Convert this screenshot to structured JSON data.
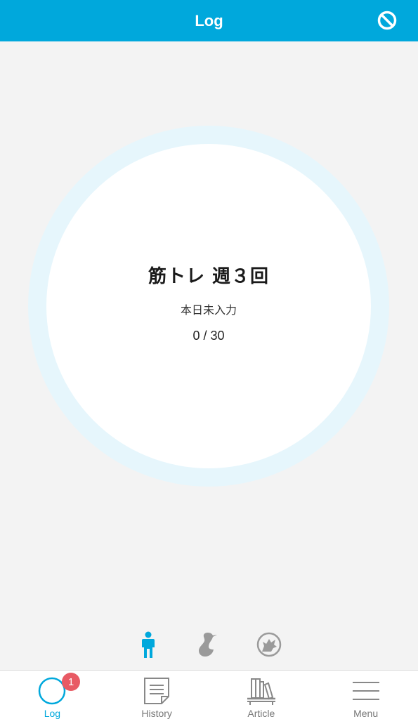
{
  "header": {
    "title": "Log",
    "action_icon": "prohibited-icon"
  },
  "goal": {
    "title": "筋トレ 週３回",
    "status": "本日未入力",
    "count": "0 / 30",
    "progress_fraction": 0
  },
  "characters": [
    {
      "icon": "person-icon",
      "selected": true
    },
    {
      "icon": "bird-icon",
      "selected": false
    },
    {
      "icon": "wolf-icon",
      "selected": false
    }
  ],
  "tabs": [
    {
      "label": "Log",
      "icon": "circle-icon",
      "active": true,
      "badge": "1"
    },
    {
      "label": "History",
      "icon": "document-icon",
      "active": false
    },
    {
      "label": "Article",
      "icon": "bookshelf-icon",
      "active": false
    },
    {
      "label": "Menu",
      "icon": "hamburger-icon",
      "active": false
    }
  ],
  "colors": {
    "primary": "#00a8dc",
    "ring_track": "#e6f6fc",
    "badge": "#e85a64",
    "inactive_icon": "#9a9a9a"
  }
}
